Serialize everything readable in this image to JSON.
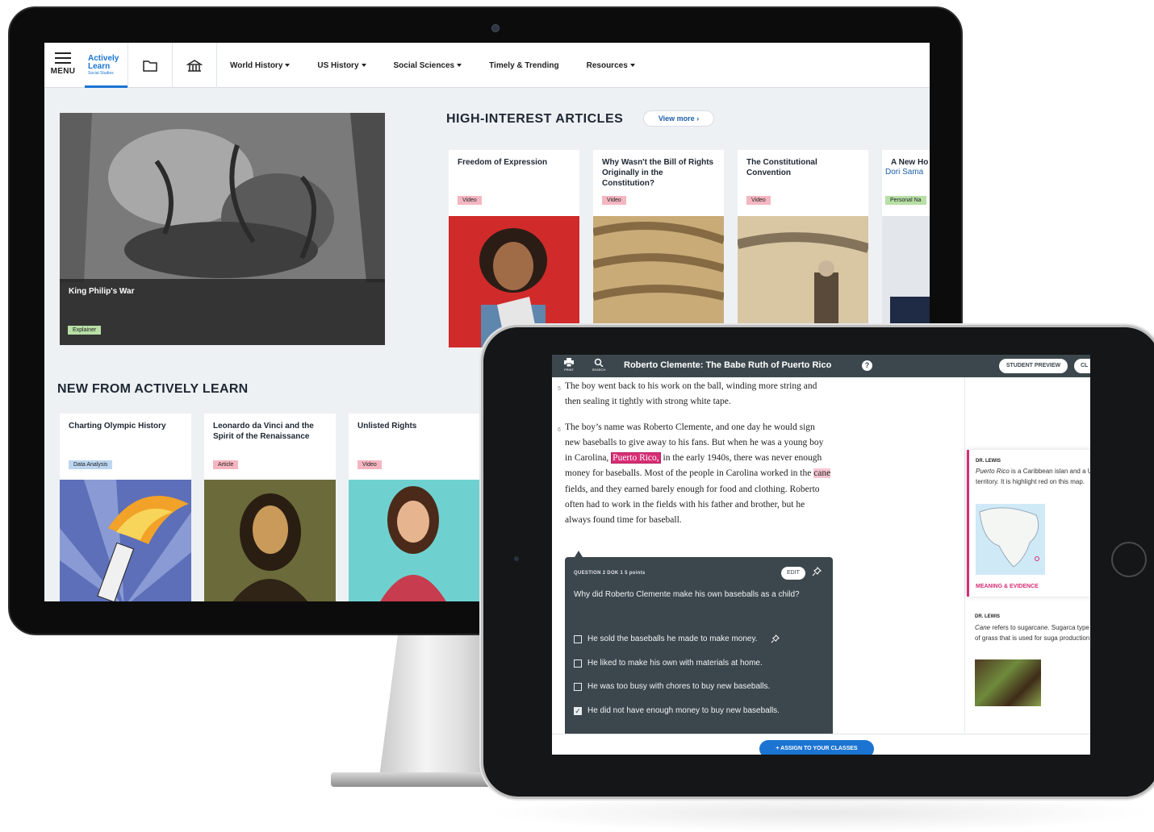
{
  "nav": {
    "menu_label": "MENU",
    "logo_line1": "Actively",
    "logo_line2": "Learn",
    "logo_sub": "Social Studies",
    "links": [
      "World History",
      "US History",
      "Social Sciences",
      "Timely & Trending",
      "Resources"
    ]
  },
  "hero": {
    "title": "King Philip's War",
    "tag": "Explainer"
  },
  "high_interest": {
    "heading": "HIGH-INTEREST ARTICLES",
    "view_more": "View more",
    "cards": [
      {
        "title": "Freedom of Expression",
        "tag": "Video"
      },
      {
        "title": "Why Wasn't the Bill of Rights Originally in the Constitution?",
        "tag": "Video"
      },
      {
        "title": "The Constitutional Convention",
        "tag": "Video"
      },
      {
        "title": "A New Ho",
        "subtitle": "Dori Sama",
        "tag": "Personal Na"
      }
    ]
  },
  "new_from": {
    "heading": "NEW FROM ACTIVELY LEARN",
    "cards": [
      {
        "title": "Charting Olympic History",
        "tag": "Data Analysis"
      },
      {
        "title": "Leonardo da Vinci and the Spirit of the Renaissance",
        "tag": "Article"
      },
      {
        "title": "Unlisted Rights",
        "tag": "Video"
      }
    ]
  },
  "reader": {
    "print_label": "PRINT",
    "search_label": "SEARCH",
    "title": "Roberto Clemente: The Babe Ruth of Puerto Rico",
    "help": "?",
    "student_preview": "STUDENT PREVIEW",
    "next_button_partial": "CL",
    "para5_num": "5",
    "para5": "The boy went back to his work on the ball, winding more string and then sealing it tightly with strong white tape.",
    "para6_num": "6",
    "para6_a": "The boy’s name was Roberto Clemente, and one day he would sign new baseballs to give away to his fans. But when he was a young boy in Carolina,",
    "para6_hl1": "Puerto Rico,",
    "para6_b": "in the early 1940s, there was never enough money for baseballs. Most of the people in Carolina worked in the",
    "para6_hl2": "cane",
    "para6_c": "fields, and they earned barely enough for food and clothing. Roberto often had to work in the fields with his father and brother, but he always found time for baseball.",
    "question": {
      "meta": "QUESTION 2   DOK 1   5 points",
      "edit": "EDIT",
      "prompt": "Why did Roberto Clemente make his own baseballs as a child?",
      "options": [
        {
          "text": "He sold the baseballs he made to make money.",
          "checked": false
        },
        {
          "text": "He liked to make his own with materials at home.",
          "checked": false
        },
        {
          "text": "He was too busy with chores to buy new baseballs.",
          "checked": false
        },
        {
          "text": "He did not have enough money to buy new baseballs.",
          "checked": true
        }
      ]
    },
    "note1": {
      "author": "DR. LEWIS",
      "text_em": "Puerto Rico",
      "text": "is a Caribbean islan and a US territory. It is highlight red on this map.",
      "category": "MEANING & EVIDENCE"
    },
    "note2": {
      "author": "DR. LEWIS",
      "text_em": "Cane",
      "text": "refers to sugarcane. Sugarca type of grass that is used for suga production."
    },
    "assign": "+ ASSIGN TO YOUR CLASSES"
  }
}
